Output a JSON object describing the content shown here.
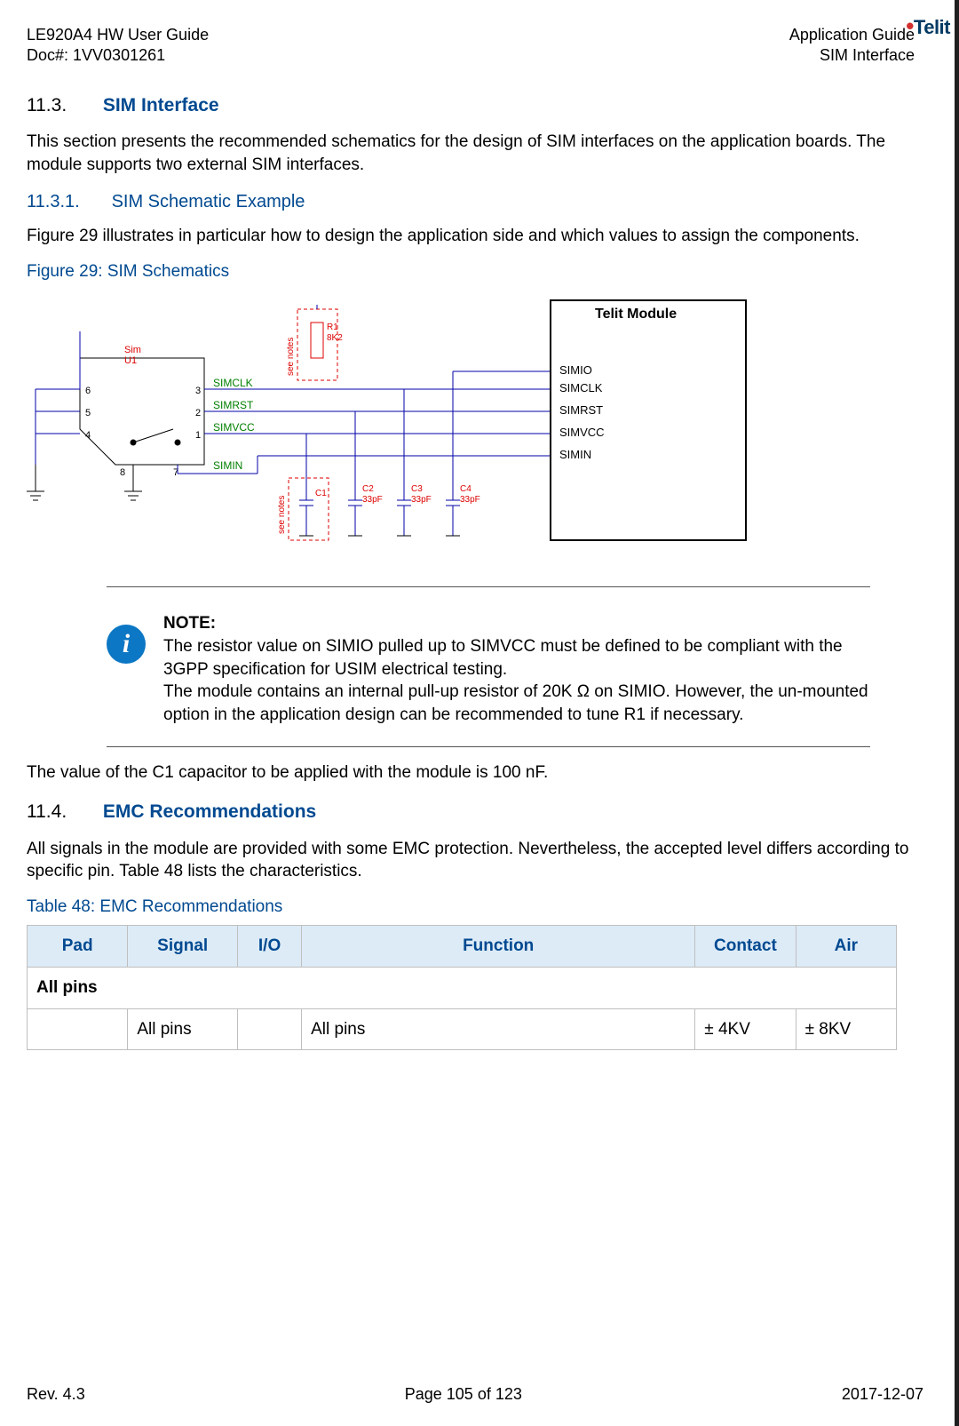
{
  "header": {
    "left1": "LE920A4 HW User Guide",
    "left2": "Doc#: 1VV0301261",
    "right1": "Application Guide",
    "right2": "SIM Interface",
    "logo_text": "Telit"
  },
  "section113": {
    "num": "11.3.",
    "title": "SIM Interface",
    "para": "This section presents the recommended schematics for the design of SIM interfaces on the application boards. The module supports two external SIM interfaces."
  },
  "sub1131": {
    "num": "11.3.1.",
    "title": "SIM Schematic Example",
    "para": "Figure 29 illustrates in particular how to design the application side and which values to assign the components.",
    "fig_caption": "Figure 29: SIM Schematics"
  },
  "schematic": {
    "sim_label": "Sim",
    "sim_ref": "U1",
    "pins_left": [
      "6",
      "5",
      "4"
    ],
    "pins_right": [
      "3",
      "2",
      "1"
    ],
    "pins_bot": [
      "8",
      "7"
    ],
    "wires": [
      "SIMCLK",
      "SIMRST",
      "SIMVCC",
      "SIMIN"
    ],
    "r1": "R1",
    "r1v": "8K2",
    "see_notes": "see notes",
    "caps": [
      {
        "ref": "C1",
        "val": ""
      },
      {
        "ref": "C2",
        "val": "33pF"
      },
      {
        "ref": "C3",
        "val": "33pF"
      },
      {
        "ref": "C4",
        "val": "33pF"
      }
    ],
    "module_title": "Telit Module",
    "module_pins": [
      "SIMIO",
      "SIMCLK",
      "SIMRST",
      "SIMVCC",
      "SIMIN"
    ]
  },
  "note": {
    "label": "NOTE:",
    "body1": "The resistor value on SIMIO pulled up to SIMVCC must be defined to be compliant with the 3GPP specification for USIM electrical testing.",
    "body2": "The module contains an internal pull-up resistor of 20K Ω on SIMIO. However, the un-mounted option in the application design can be recommended to tune R1 if necessary."
  },
  "c1line": "The value of the C1 capacitor to be applied with the module is 100 nF.",
  "section114": {
    "num": "11.4.",
    "title": "EMC Recommendations",
    "para": "All signals in the module are provided with some EMC protection. Nevertheless, the accepted level differs according to specific pin. Table 48 lists the characteristics.",
    "tbl_caption": "Table 48: EMC Recommendations"
  },
  "table": {
    "headers": [
      "Pad",
      "Signal",
      "I/O",
      "Function",
      "Contact",
      "Air"
    ],
    "group": "All pins",
    "row": {
      "pad": "",
      "signal": "All pins",
      "io": "",
      "function": "All pins",
      "contact": "± 4KV",
      "air": "± 8KV"
    }
  },
  "footer": {
    "left": "Rev. 4.3",
    "center": "Page 105 of 123",
    "right": "2017-12-07"
  }
}
